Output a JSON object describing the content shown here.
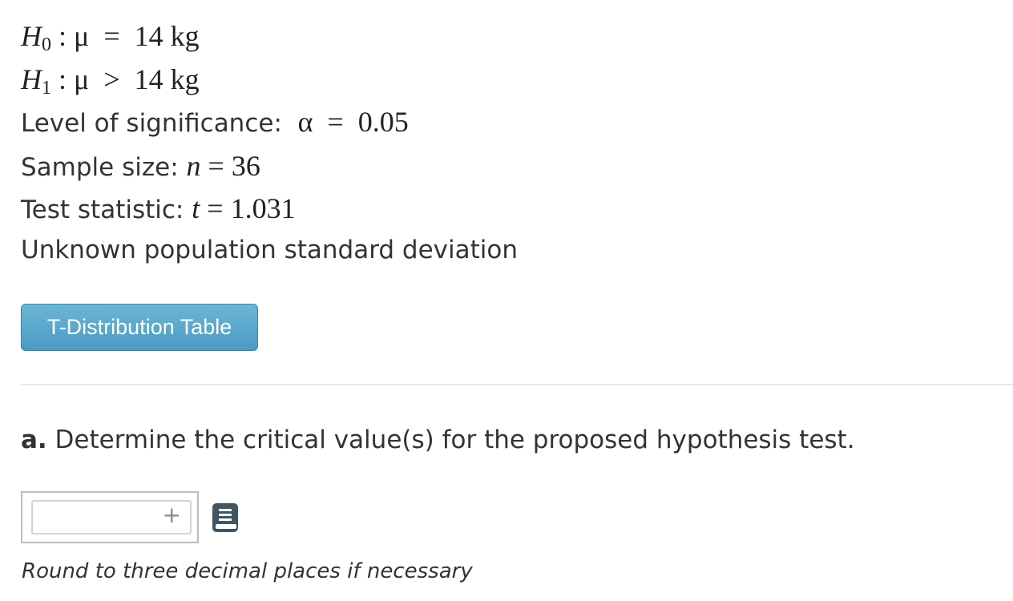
{
  "hypotheses": {
    "h0": {
      "symbol": "H",
      "subscript": "0",
      "sep": " : ",
      "param": "μ",
      "op": "  =  ",
      "value": "14 kg"
    },
    "h1": {
      "symbol": "H",
      "subscript": "1",
      "sep": " : ",
      "param": "μ",
      "op": "  >  ",
      "value": "14 kg"
    }
  },
  "significance": {
    "label": "Level of significance:  ",
    "symbol": "α",
    "op": "  =  ",
    "value": "0.05"
  },
  "sample_size": {
    "label": "Sample size: ",
    "symbol": "n",
    "op": " = ",
    "value": "36"
  },
  "test_statistic": {
    "label": "Test statistic: ",
    "symbol": "t",
    "op": " = ",
    "value": "1.031"
  },
  "note": "Unknown population standard deviation",
  "table_button": {
    "label": "T-Distribution Table"
  },
  "question": {
    "letter": "a.",
    "text": " Determine the critical value(s) for the proposed hypothesis test."
  },
  "answer": {
    "value": "",
    "plus": "+"
  },
  "hint": "Round to three decimal places if necessary",
  "colors": {
    "button": "#4a9bc2",
    "text": "#333333",
    "book_icon": "#3f5660"
  }
}
